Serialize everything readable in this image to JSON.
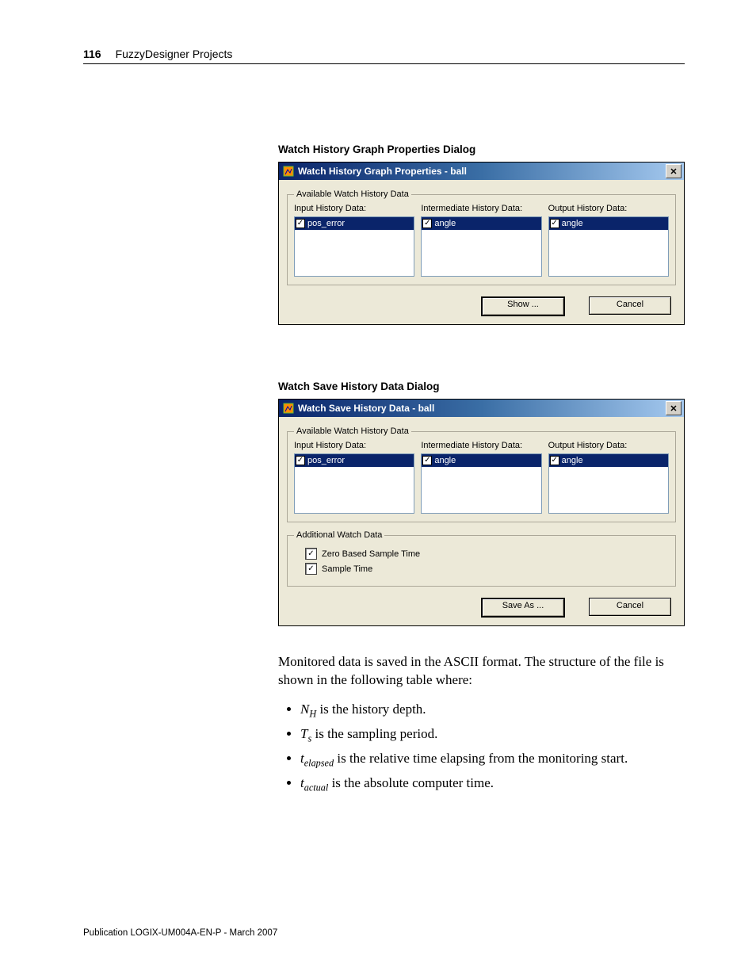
{
  "header": {
    "page_num": "116",
    "chapter": "FuzzyDesigner Projects"
  },
  "dialog1": {
    "heading": "Watch History Graph Properties Dialog",
    "title": "Watch History Graph Properties - ball",
    "group_label": "Available Watch History Data",
    "cols": {
      "input": {
        "label": "Input History Data:",
        "item": "pos_error"
      },
      "intermediate": {
        "label": "Intermediate History Data:",
        "item": "angle"
      },
      "output": {
        "label": "Output History Data:",
        "item": "angle"
      }
    },
    "buttons": {
      "primary": "Show ...",
      "cancel": "Cancel"
    }
  },
  "dialog2": {
    "heading": "Watch Save History Data Dialog",
    "title": "Watch Save History Data - ball",
    "group_label": "Available Watch History Data",
    "cols": {
      "input": {
        "label": "Input History Data:",
        "item": "pos_error"
      },
      "intermediate": {
        "label": "Intermediate History Data:",
        "item": "angle"
      },
      "output": {
        "label": "Output History Data:",
        "item": "angle"
      }
    },
    "group2_label": "Additional Watch Data",
    "check1": "Zero Based Sample Time",
    "check2": "Sample Time",
    "buttons": {
      "primary": "Save As ...",
      "cancel": "Cancel"
    }
  },
  "body": {
    "para": "Monitored data is saved in the ASCII format. The structure of the file is shown in the following table where:",
    "bullets": {
      "b1_suffix": " is the history depth.",
      "b2_suffix": " is the sampling period.",
      "b3_suffix": " is the relative time elapsing from the monitoring start.",
      "b4_suffix": " is the absolute computer time."
    }
  },
  "footer": "Publication LOGIX-UM004A-EN-P - March 2007"
}
